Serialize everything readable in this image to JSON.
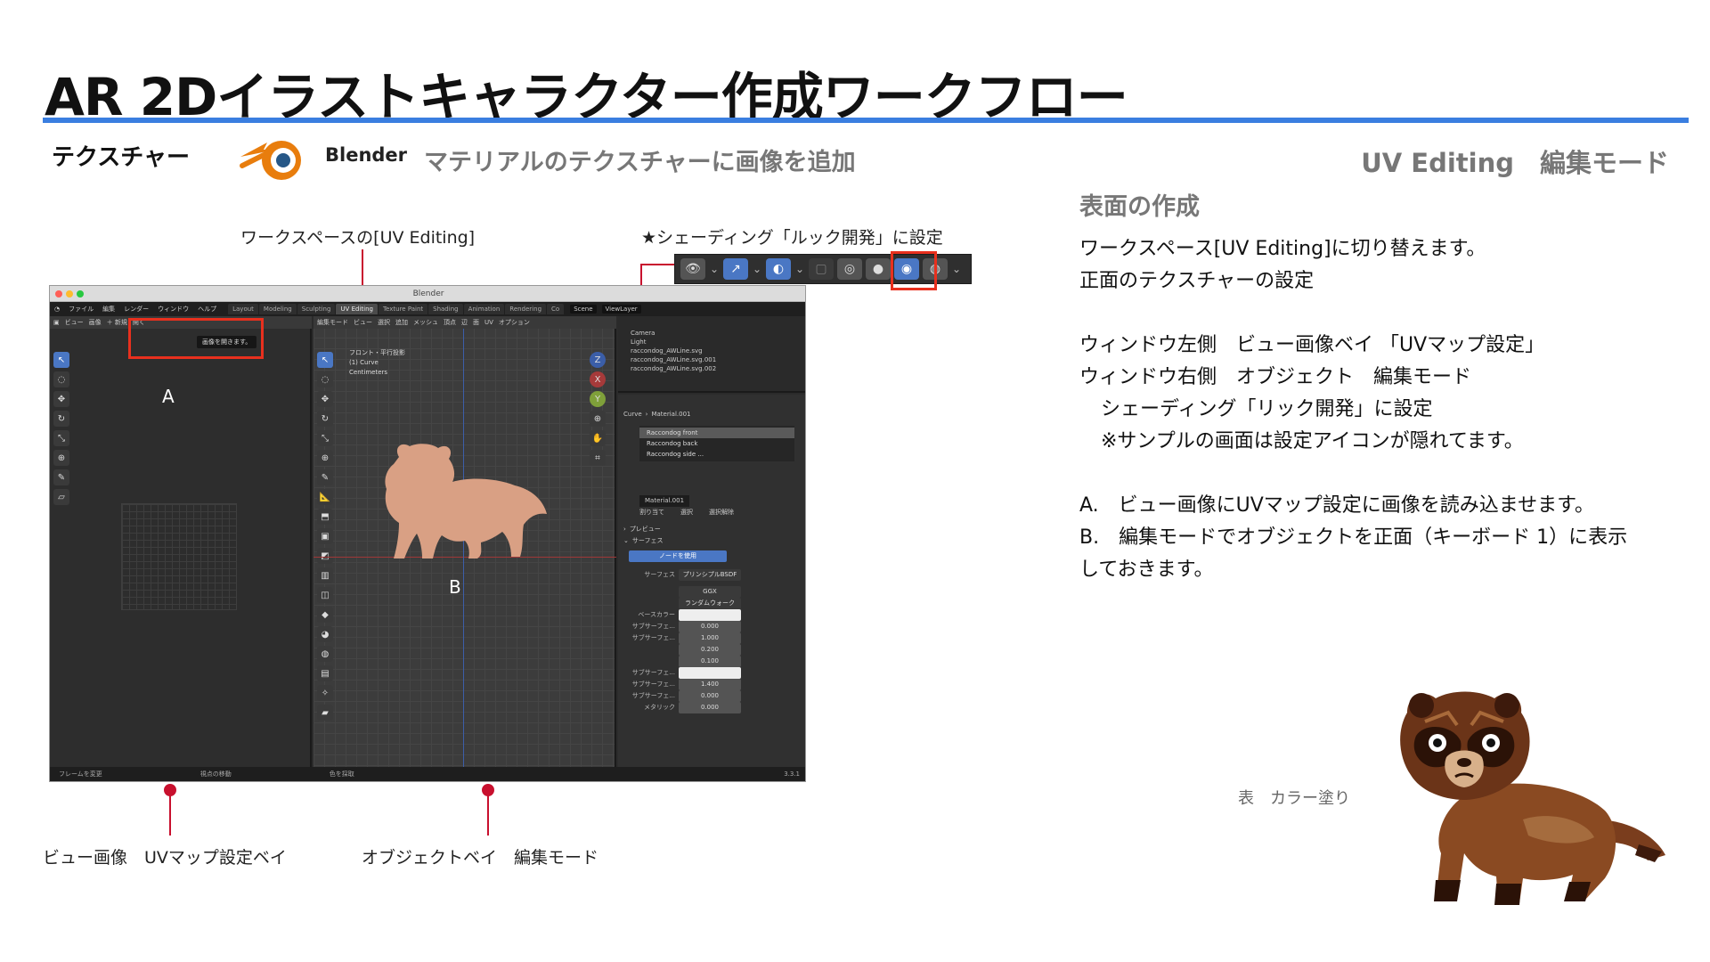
{
  "header": {
    "title": "AR 2Dイラストキャラクター作成ワークフロー",
    "section": "テクスチャー",
    "app_name": "Blender",
    "subtitle": "マテリアルのテクスチャーに画像を追加",
    "mode": "UV Editing　編集モード"
  },
  "annotations": {
    "workspace": "ワークスペースの[UV Editing]",
    "shading": "★シェーディング「ルック開発」に設定",
    "view_image": "ビュー画像　UVマップ設定ベイ",
    "object": "オブジェクトベイ　編集モード",
    "label_a": "A",
    "label_b": "B"
  },
  "blender": {
    "window_title": "Blender",
    "menu": [
      "ファイル",
      "編集",
      "レンダー",
      "ウィンドウ",
      "ヘルプ"
    ],
    "tabs": [
      "Layout",
      "Modeling",
      "Sculpting",
      "UV Editing",
      "Texture Paint",
      "Shading",
      "Animation",
      "Rendering",
      "Co"
    ],
    "active_tab": "UV Editing",
    "scene": "Scene",
    "view_layer": "ViewLayer",
    "left_header": [
      "ビュー",
      "画像",
      "＋ 新規",
      "開く"
    ],
    "tooltip": "画像を開きます。",
    "view_header": [
      "編集モード",
      "ビュー",
      "選択",
      "追加",
      "メッシュ",
      "頂点",
      "辺",
      "面",
      "UV"
    ],
    "view_options": "オプション",
    "view_info": [
      "フロント・平行投影",
      "(1) Curve",
      "Centimeters"
    ],
    "outliner": [
      "Camera",
      "Light",
      "raccondog_AWLine.svg",
      "raccondog_AWLine.svg.001",
      "raccondog_AWLine.svg.002"
    ],
    "props_breadcrumb": [
      "Curve",
      "Material.001"
    ],
    "material_slots": [
      "Raccondog front",
      "Raccondog back",
      "Raccondog side ..."
    ],
    "material_name": "Material.001",
    "material_buttons": [
      "割り当て",
      "選択",
      "選択解除"
    ],
    "panels": [
      "プレビュー",
      "サーフェス"
    ],
    "use_nodes": "ノードを使用",
    "surface_label": "サーフェス",
    "surface_value": "プリンシプルBSDF",
    "dist_1": "GGX",
    "dist_2": "ランダムウォーク",
    "prop_rows": [
      {
        "label": "ベースカラー",
        "value": ""
      },
      {
        "label": "サブサーフェ...",
        "value": "0.000"
      },
      {
        "label": "サブサーフェ...",
        "value": "1.000"
      },
      {
        "label": "",
        "value": "0.200"
      },
      {
        "label": "",
        "value": "0.100"
      },
      {
        "label": "サブサーフェ...",
        "value": ""
      },
      {
        "label": "サブサーフェ...",
        "value": "1.400"
      },
      {
        "label": "サブサーフェ...",
        "value": "0.000"
      },
      {
        "label": "メタリック",
        "value": "0.000"
      }
    ],
    "status": [
      "フレームを変更",
      "視点の移動",
      "色を採取"
    ],
    "version": "3.3.1"
  },
  "content": {
    "heading": "表面の作成",
    "lines": [
      "ワークスペース[UV Editing]に切り替えます。",
      "正面のテクスチャーの設定",
      "",
      "ウィンドウ左側　ビュー画像ベイ 「UVマップ設定」",
      "ウィンドウ右側　オブジェクト　編集モード",
      "シェーディング「リック開発」に設定",
      "※サンプルの画面は設定アイコンが隠れてます。",
      "",
      "A.　ビュー画像にUVマップ設定に画像を読み込ませます。",
      "B.　編集モードでオブジェクトを正面（キーボード 1）に表示",
      "しておきます。"
    ],
    "caption": "表　カラー塗り"
  },
  "colors": {
    "accent_rule": "#3a7ee0",
    "highlight_red": "#e8301e",
    "pin_red": "#c8102e",
    "silhouette": "#d9a084"
  }
}
